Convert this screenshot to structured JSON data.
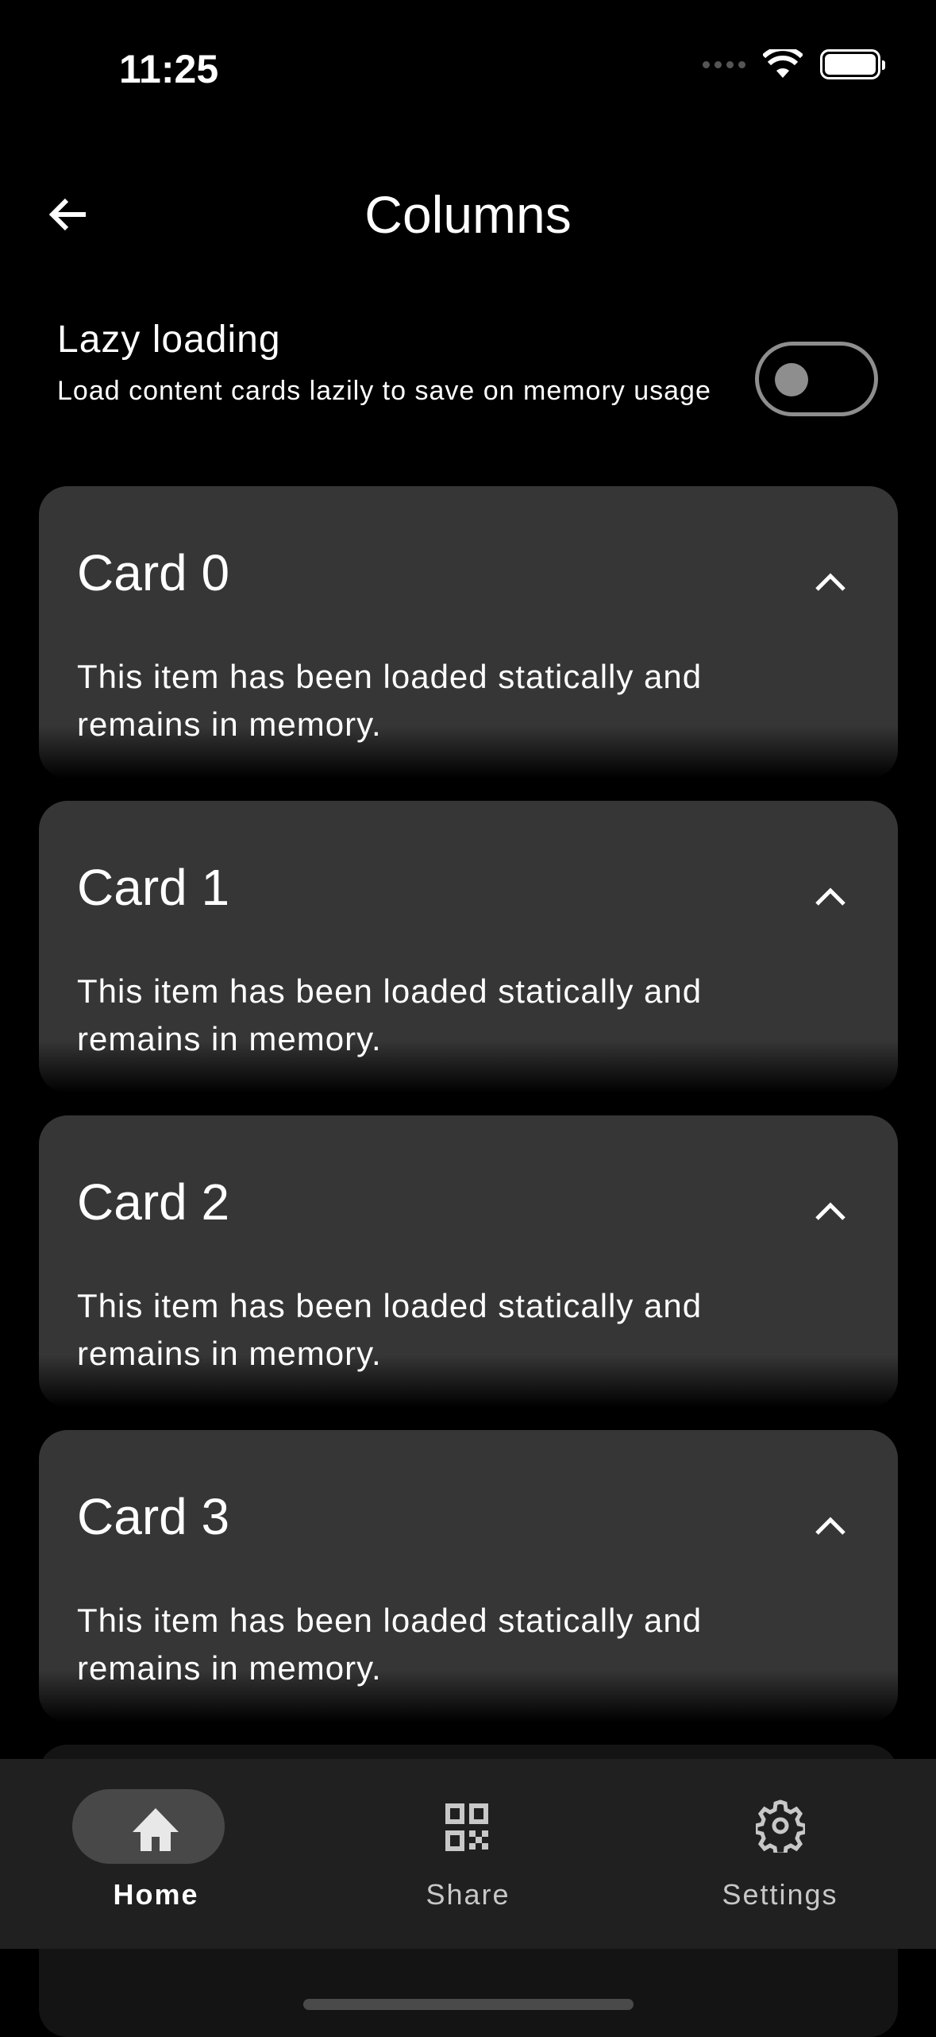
{
  "status_bar": {
    "time": "11:25"
  },
  "header": {
    "title": "Columns"
  },
  "lazy_loading": {
    "label": "Lazy loading",
    "description": "Load content cards lazily to save on memory usage",
    "enabled": false
  },
  "cards": [
    {
      "title": "Card 0",
      "body": "This item has been loaded statically and remains in memory.",
      "expanded": true
    },
    {
      "title": "Card 1",
      "body": "This item has been loaded statically and remains in memory.",
      "expanded": true
    },
    {
      "title": "Card 2",
      "body": "This item has been loaded statically and remains in memory.",
      "expanded": true
    },
    {
      "title": "Card 3",
      "body": "This item has been loaded statically and remains in memory.",
      "expanded": true
    }
  ],
  "nav": {
    "items": [
      {
        "label": "Home",
        "icon": "home-icon",
        "active": true
      },
      {
        "label": "Share",
        "icon": "qr-code-icon"
      },
      {
        "label": "Settings",
        "icon": "gear-icon"
      }
    ]
  }
}
